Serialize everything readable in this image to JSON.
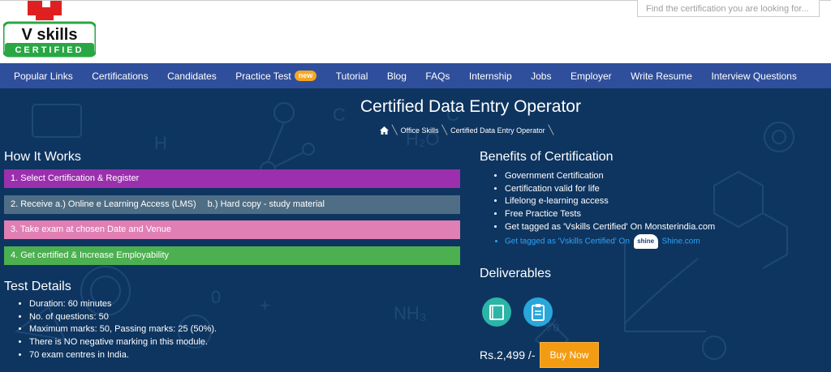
{
  "header": {
    "logo_text": "V skills",
    "logo_subtext": "CERTIFIED",
    "search_placeholder": "Find the certification you are looking for..."
  },
  "nav": {
    "items": [
      {
        "label": "Popular Links"
      },
      {
        "label": "Certifications"
      },
      {
        "label": "Candidates"
      },
      {
        "label": "Practice Test",
        "badge": "new"
      },
      {
        "label": "Tutorial"
      },
      {
        "label": "Blog"
      },
      {
        "label": "FAQs"
      },
      {
        "label": "Internship"
      },
      {
        "label": "Jobs"
      },
      {
        "label": "Employer"
      },
      {
        "label": "Write Resume"
      },
      {
        "label": "Interview Questions"
      }
    ]
  },
  "hero": {
    "title": "Certified Data Entry Operator",
    "breadcrumb": [
      "Office Skills",
      "Certified Data Entry Operator"
    ]
  },
  "how_it_works": {
    "title": "How It Works",
    "steps": [
      "1. Select Certification & Register",
      "2. Receive a.) Online e Learning Access (LMS)",
      "b.) Hard copy - study material",
      "3. Take exam at chosen Date and Venue",
      "4. Get certified & Increase Employability"
    ]
  },
  "test_details": {
    "title": "Test Details",
    "items": [
      "Duration: 60 minutes",
      "No. of questions: 50",
      "Maximum marks: 50, Passing marks: 25 (50%).",
      "There is NO negative marking in this module.",
      "70 exam centres in India."
    ]
  },
  "benefits": {
    "title": "Benefits of Certification",
    "items": [
      "Government Certification",
      "Certification valid for life",
      "Lifelong e-learning access",
      "Free Practice Tests",
      "Get tagged as 'Vskills Certified' On Monsterindia.com"
    ],
    "shine_prefix": "Get tagged as 'Vskills Certified' On",
    "shine_logo": "shine",
    "shine_suffix": "Shine.com"
  },
  "deliverables": {
    "title": "Deliverables",
    "icons": [
      "book-icon",
      "clipboard-icon"
    ]
  },
  "purchase": {
    "price": "Rs.2,499 /-",
    "button_label": "Buy Now"
  },
  "colors": {
    "nav_bg": "#2f4f9c",
    "hero_bg": "#0e3560",
    "step1": "#9b2fae",
    "step2": "#4f6e86",
    "step3": "#e07fb4",
    "step4": "#4caf50",
    "buy_button": "#f39c12",
    "badge": "#f5a623"
  }
}
